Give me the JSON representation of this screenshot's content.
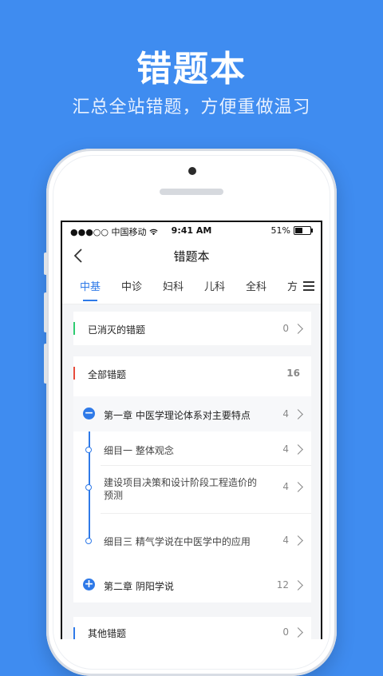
{
  "hero": {
    "title": "错题本",
    "subtitle": "汇总全站错题，方便重做温习"
  },
  "statusbar": {
    "carrier": "●●●○○ 中国移动 ",
    "wifi_icon": "wifi-icon",
    "time": "9:41 AM",
    "battery": "51%"
  },
  "navbar": {
    "title": "错题本"
  },
  "tabs": [
    {
      "label": "中基",
      "active": true
    },
    {
      "label": "中诊",
      "active": false
    },
    {
      "label": "妇科",
      "active": false
    },
    {
      "label": "儿科",
      "active": false
    },
    {
      "label": "全科",
      "active": false
    },
    {
      "label": "方",
      "active": false
    }
  ],
  "sections": {
    "eliminated": {
      "label": "已消灭的错题",
      "count": "0",
      "accent": "#2ecc71"
    },
    "all": {
      "label": "全部错题",
      "count": "16",
      "accent": "#e74c3c",
      "chapters": [
        {
          "label": "第一章  中医学理论体系对主要特点",
          "count": "4",
          "expanded": true,
          "items": [
            {
              "label": "细目一  整体观念",
              "count": "4"
            },
            {
              "label": "建设项目决策和设计阶段工程造价的预测",
              "count": "4"
            },
            {
              "label": "细目三  精气学说在中医学中的应用",
              "count": "4"
            }
          ]
        },
        {
          "label": "第二章   阴阳学说",
          "count": "12",
          "expanded": false,
          "items": []
        }
      ]
    },
    "other": {
      "label": "其他错题",
      "count": "0",
      "accent": "#2f7ae8"
    }
  },
  "colors": {
    "background": "#3f8cf0",
    "accent": "#2f7ae8"
  }
}
